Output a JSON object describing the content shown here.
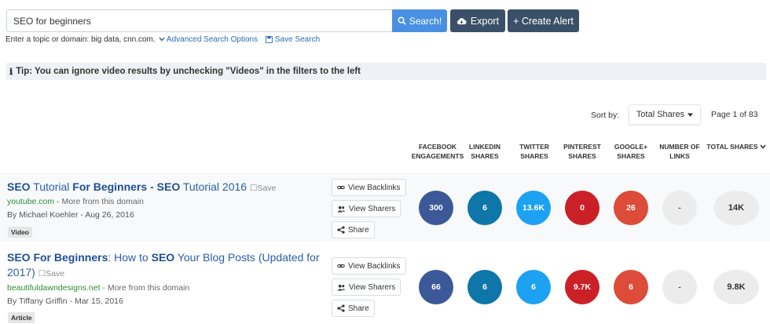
{
  "search": {
    "query": "SEO for beginners",
    "button_label": "Search!",
    "hint_text": "Enter a topic or domain: big data, cnn.com.",
    "advanced_label": "Advanced Search Options",
    "save_search_label": "Save Search"
  },
  "toolbar": {
    "export_label": "Export",
    "create_alert_label": "+ Create Alert"
  },
  "tip": {
    "text": "Tip: You can ignore video results by unchecking \"Videos\" in the filters to the left"
  },
  "sort": {
    "label": "Sort by:",
    "selected": "Total Shares",
    "page_info": "Page 1 of 83"
  },
  "columns": [
    "FACEBOOK ENGAGEMENTS",
    "LINKEDIN SHARES",
    "TWITTER SHARES",
    "PINTEREST SHARES",
    "GOOGLE+ SHARES",
    "NUMBER OF LINKS",
    "TOTAL SHARES"
  ],
  "actions": {
    "backlinks_label": "View Backlinks",
    "sharers_label": "View Sharers",
    "share_label": "Share"
  },
  "results": [
    {
      "title_parts": [
        "SEO",
        " Tutorial ",
        "For Beginners",
        " - ",
        "SEO",
        " Tutorial 2016"
      ],
      "save_label": "Save",
      "domain": "youtube.com",
      "more_text": " - More from this domain",
      "author_line": "By Michael Koehler - Aug 26, 2016",
      "tag": "Video",
      "facebook": "300",
      "linkedin": "6",
      "twitter": "13.6K",
      "pinterest": "0",
      "google": "26",
      "links": "-",
      "total": "14K"
    },
    {
      "title_parts": [
        "SEO For Beginners",
        ": How to ",
        "SEO",
        " Your Blog Posts (Updated for 2017)"
      ],
      "save_label": "Save",
      "domain": "beautifuldawndesigns.net",
      "more_text": " - More from this domain",
      "author_line": "By Tiffany Griffin - Mar 15, 2016",
      "tag": "Article",
      "facebook": "66",
      "linkedin": "6",
      "twitter": "6",
      "pinterest": "9.7K",
      "google": "6",
      "links": "-",
      "total": "9.8K"
    }
  ],
  "colors": {
    "facebook": "#3b5998",
    "linkedin": "#0e76a8",
    "twitter": "#1da1f2",
    "pinterest": "#cb2027",
    "google": "#dd4b39",
    "search_button": "#4a90e2",
    "dark_button": "#3a5068"
  }
}
